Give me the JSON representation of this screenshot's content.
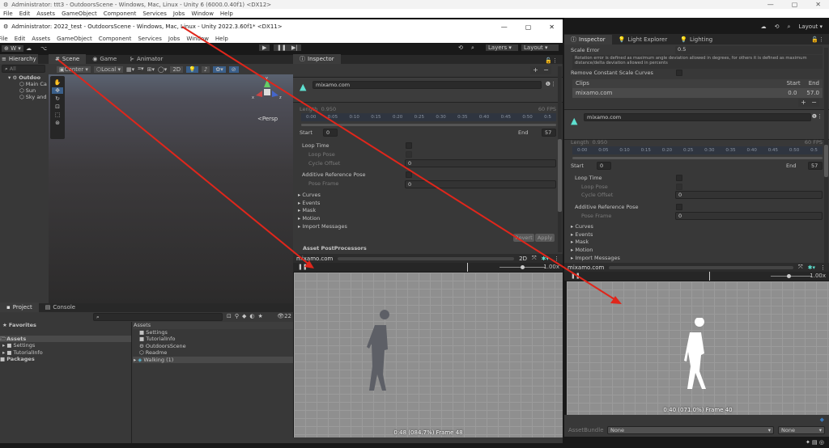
{
  "back_window": {
    "title": "Administrator: ttt3 - OutdoorsScene - Windows, Mac, Linux - Unity 6 (6000.0.40f1) <DX12>",
    "menu": [
      "File",
      "Edit",
      "Assets",
      "GameObject",
      "Component",
      "Services",
      "Jobs",
      "Window",
      "Help"
    ],
    "toolbar": {
      "layout": "Layout"
    },
    "tabs": [
      "Inspector",
      "Light Explorer",
      "Lighting"
    ],
    "inspector": {
      "scale_error_label": "Scale Error",
      "scale_error_value": "0.5",
      "help_text": "Rotation error is defined as maximum angle deviation allowed in degrees, for others it is defined as maximum distance/delta deviation allowed in percents",
      "remove_constant_label": "Remove Constant Scale Curves",
      "clips": {
        "header": "Clips",
        "start_header": "Start",
        "end_header": "End",
        "name": "mixamo.com",
        "start": "0.0",
        "end": "57.0"
      },
      "plus": "+",
      "minus": "−",
      "clip_name": "mixamo.com",
      "length_label": "Length",
      "length": "0.950",
      "fps": "60 FPS",
      "ticks": [
        "0:00",
        "0:05",
        "0:10",
        "0:15",
        "0:20",
        "0:25",
        "0:30",
        "0:35",
        "0:40",
        "0:45",
        "0:50",
        "0:5"
      ],
      "start_label": "Start",
      "start": "0",
      "end_label": "End",
      "end": "57",
      "loop_time": "Loop Time",
      "loop_pose": "Loop Pose",
      "cycle_offset": "Cycle Offset",
      "cycle_offset_value": "0",
      "additive": "Additive Reference Pose",
      "pose_frame": "Pose Frame",
      "pose_frame_value": "0",
      "foldouts": [
        "Curves",
        "Events",
        "Mask",
        "Motion",
        "Import Messages"
      ]
    },
    "preview": {
      "name": "mixamo.com",
      "speed": "1.00x",
      "status": "0:40 (071.0%) Frame 40",
      "playhead": 0.71
    },
    "asset_bundle": {
      "label": "AssetBundle",
      "value": "None",
      "variant": "None"
    }
  },
  "front_window": {
    "title": "Administrator: 2022_test - OutdoorsScene - Windows, Mac, Linux - Unity 2022.3.60f1* <DX11>",
    "menu": [
      "File",
      "Edit",
      "Assets",
      "GameObject",
      "Component",
      "Services",
      "Jobs",
      "Window",
      "Help"
    ],
    "toolbar": {
      "account": "W",
      "layers": "Layers",
      "layout": "Layout"
    },
    "hierarchy": {
      "tab": "Hierarchy",
      "search": "All",
      "scene": "Outdoo",
      "items": [
        "Main Ca",
        "Sun",
        "Sky and"
      ]
    },
    "scene_tabs": [
      "Scene",
      "Game",
      "Animator"
    ],
    "scene_toolbar": {
      "pivot": "Center",
      "space": "Local",
      "mode2d": "2D"
    },
    "gizmo": {
      "x": "x",
      "y": "y",
      "z": "z",
      "persp": "Persp"
    },
    "inspector": {
      "tab": "Inspector",
      "clip_name": "mixamo.com",
      "length_label": "Length",
      "length": "0.950",
      "fps": "60 FPS",
      "ticks": [
        "0:00",
        "0:05",
        "0:10",
        "0:15",
        "0:20",
        "0:25",
        "0:30",
        "0:35",
        "0:40",
        "0:45",
        "0:50",
        "0:5"
      ],
      "start_label": "Start",
      "start": "0",
      "end_label": "End",
      "end": "57",
      "loop_time": "Loop Time",
      "loop_pose": "Loop Pose",
      "cycle_offset": "Cycle Offset",
      "cycle_offset_value": "0",
      "additive": "Additive Reference Pose",
      "pose_frame": "Pose Frame",
      "pose_frame_value": "0",
      "foldouts": [
        "Curves",
        "Events",
        "Mask",
        "Motion",
        "Import Messages"
      ],
      "revert": "Revert",
      "apply": "Apply",
      "postprocessors": "Asset PostProcessors",
      "plus": "+",
      "minus": "−"
    },
    "preview": {
      "name": "mixamo.com",
      "mode2d": "2D",
      "speed": "1.00x",
      "status": "0:48 (084.7%) Frame 48",
      "playhead": 0.847
    },
    "project": {
      "tabs": [
        "Project",
        "Console"
      ],
      "hidden_count": "22",
      "favorites": "Favorites",
      "tree": [
        "Assets",
        "Settings",
        "TutorialInfo",
        "Packages"
      ],
      "breadcrumb": "Assets",
      "files": [
        "Settings",
        "TutorialInfo",
        "OutdoorsScene",
        "Readme",
        "Walking (1)"
      ]
    }
  },
  "colors": {
    "annotation": "#e0261b",
    "accent": "#3a79bb"
  }
}
